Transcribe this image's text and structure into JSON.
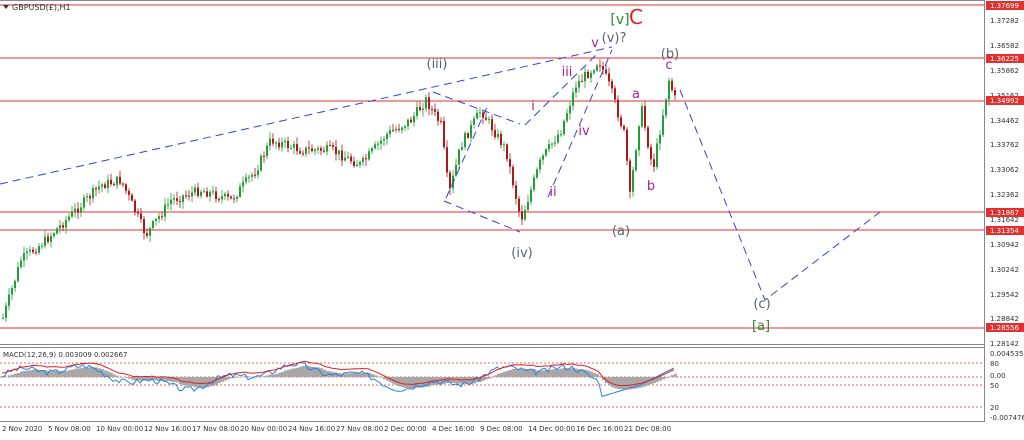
{
  "header": {
    "symbol_label": "GBPUSD(£),H1",
    "macd_label": "MACD(12,26,9) 0.003009 0.002667"
  },
  "colors": {
    "up_candle": "#22a037",
    "down_candle": "#b01818",
    "level_line": "#e03030",
    "wave_dash": "#3344cc",
    "wave_label_gray": "#5a6470",
    "wave_label_magenta": "#b0208a",
    "wave_label_green": "#2d8a2d",
    "macd_hist": "#a8a8a8",
    "macd_main": "#2a80e0",
    "macd_signal": "#e02020"
  },
  "chart_data": {
    "type": "candlestick",
    "price_axis_ticks": [
      "1.37282",
      "1.36582",
      "1.35862",
      "1.35162",
      "1.34462",
      "1.33762",
      "1.33062",
      "1.32362",
      "1.31642",
      "1.30942",
      "1.30242",
      "1.29542",
      "1.28842",
      "1.28142"
    ],
    "price_levels": [
      "1.37699",
      "1.36225",
      "1.34992",
      "1.31867",
      "1.31354",
      "1.28556"
    ],
    "x_axis_labels": [
      "2 Nov 2020",
      "5 Nov 08:00",
      "10 Nov 00:00",
      "12 Nov 16:00",
      "17 Nov 08:00",
      "20 Nov 00:00",
      "24 Nov 16:00",
      "27 Nov 08:00",
      "2 Dec 00:00",
      "4 Dec 16:00",
      "9 Dec 08:00",
      "14 Dec 00:00",
      "16 Dec 16:00",
      "21 Dec 08:00"
    ],
    "wave_labels": [
      {
        "text": "(iii)",
        "style": "gray"
      },
      {
        "text": "(iv)",
        "style": "gray"
      },
      {
        "text": "(v)?",
        "style": "gray"
      },
      {
        "text": "[v]",
        "style": "green"
      },
      {
        "text": "C",
        "style": "red"
      },
      {
        "text": "i",
        "style": "magenta"
      },
      {
        "text": "ii",
        "style": "magenta"
      },
      {
        "text": "iii",
        "style": "magenta"
      },
      {
        "text": "iv",
        "style": "magenta"
      },
      {
        "text": "v",
        "style": "magenta"
      },
      {
        "text": "a",
        "style": "magenta"
      },
      {
        "text": "b",
        "style": "magenta"
      },
      {
        "text": "c",
        "style": "magenta"
      },
      {
        "text": "(a)",
        "style": "gray"
      },
      {
        "text": "(b)",
        "style": "gray"
      },
      {
        "text": "(c)",
        "style": "gray"
      },
      {
        "text": "[a]",
        "style": "green"
      }
    ],
    "macd": {
      "params": "12,26,9",
      "main": 0.003009,
      "signal": 0.002667,
      "axis_ticks": [
        "0.004535",
        "80",
        "0.00",
        "50",
        "20",
        "-0.007476"
      ]
    }
  }
}
